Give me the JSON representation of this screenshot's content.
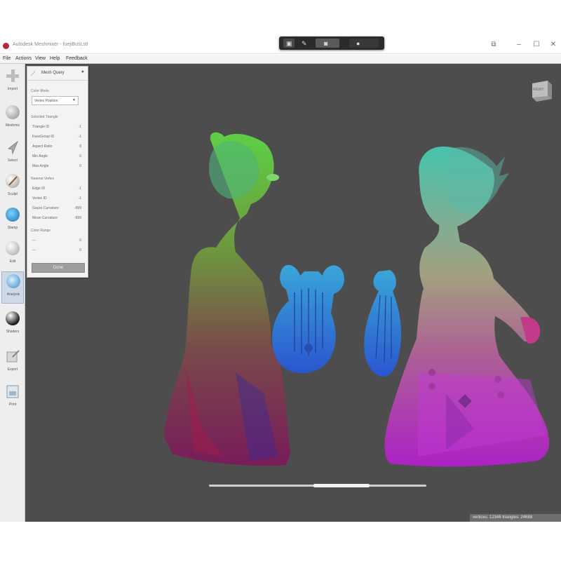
{
  "window": {
    "title": "Autodesk Meshmixer - fuejiBust.stl",
    "minimize": "–",
    "maximize": "☐",
    "close": "✕"
  },
  "menubar": {
    "items": [
      "File",
      "Actions",
      "View",
      "Help",
      "Feedback"
    ]
  },
  "left_toolbar": {
    "tools": [
      {
        "label": "Import",
        "icon": "plus-icon"
      },
      {
        "label": "Meshmix",
        "icon": "meshmix-sphere-icon"
      },
      {
        "label": "Select",
        "icon": "select-arrow-icon"
      },
      {
        "label": "Sculpt",
        "icon": "brush-icon"
      },
      {
        "label": "Stamp",
        "icon": "stamp-icon"
      },
      {
        "label": "Edit",
        "icon": "edit-icon"
      },
      {
        "label": "Analysis",
        "icon": "analysis-icon",
        "active": true
      },
      {
        "label": "Shaders",
        "icon": "shader-sphere-icon"
      },
      {
        "label": "Export",
        "icon": "export-icon"
      },
      {
        "label": "Print",
        "icon": "print-icon"
      }
    ]
  },
  "panel": {
    "title": "Mesh Query",
    "color_mode_label": "Color Mode",
    "color_mode_value": "Vertex Position",
    "selected_triangle_label": "Selected Triangle",
    "triangle_rows": [
      {
        "label": "Triangle ID",
        "value": "-1"
      },
      {
        "label": "FaceGroup ID",
        "value": "-1"
      },
      {
        "label": "Aspect Ratio",
        "value": "0"
      },
      {
        "label": "Min Angle",
        "value": "0"
      },
      {
        "label": "Max Angle",
        "value": "0"
      }
    ],
    "nearest_vertex_label": "Nearest Vertex",
    "vertex_rows": [
      {
        "label": "Edge ID",
        "value": "-1"
      },
      {
        "label": "Vertex ID",
        "value": "-1"
      },
      {
        "label": "Gauss Curvature",
        "value": "-999"
      },
      {
        "label": "Mean Curvature",
        "value": "-999"
      }
    ],
    "color_range_label": "Color Range",
    "range_rows": [
      {
        "label": "—",
        "value": "0"
      },
      {
        "label": "—",
        "value": "0"
      }
    ],
    "done_label": "Done"
  },
  "viewport": {
    "viewcube_label": "RIGHT",
    "status_text": "vertices: 12346 triangles: 24688",
    "timeline_progress": 0.74
  },
  "colors": {
    "viewport_bg": "#4d4d4d",
    "panel_bg": "#f3f3f3",
    "active_tool": "#cfd8e6"
  }
}
